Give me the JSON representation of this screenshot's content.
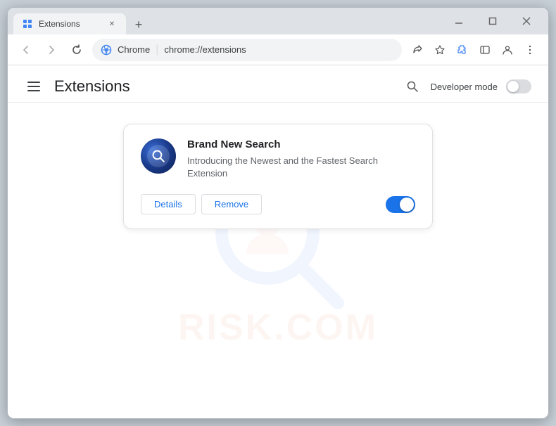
{
  "browser": {
    "tab": {
      "title": "Extensions",
      "favicon_alt": "extensions-favicon"
    },
    "new_tab_label": "+",
    "window_controls": {
      "minimize": "−",
      "maximize": "□",
      "close": "✕"
    },
    "address_bar": {
      "chrome_label": "Chrome",
      "url": "chrome://extensions",
      "separator": "|"
    },
    "toolbar": {
      "share_icon": "share-icon",
      "star_icon": "star-icon",
      "puzzle_icon": "puzzle-icon",
      "sidebar_icon": "sidebar-icon",
      "profile_icon": "profile-icon",
      "menu_icon": "menu-icon"
    }
  },
  "page": {
    "title": "Extensions",
    "header": {
      "dev_mode_label": "Developer mode"
    },
    "extension": {
      "name": "Brand New Search",
      "description": "Introducing the Newest and the Fastest Search Extension",
      "details_label": "Details",
      "remove_label": "Remove",
      "enabled": true
    }
  },
  "watermark": {
    "text": "RISK.COM"
  }
}
